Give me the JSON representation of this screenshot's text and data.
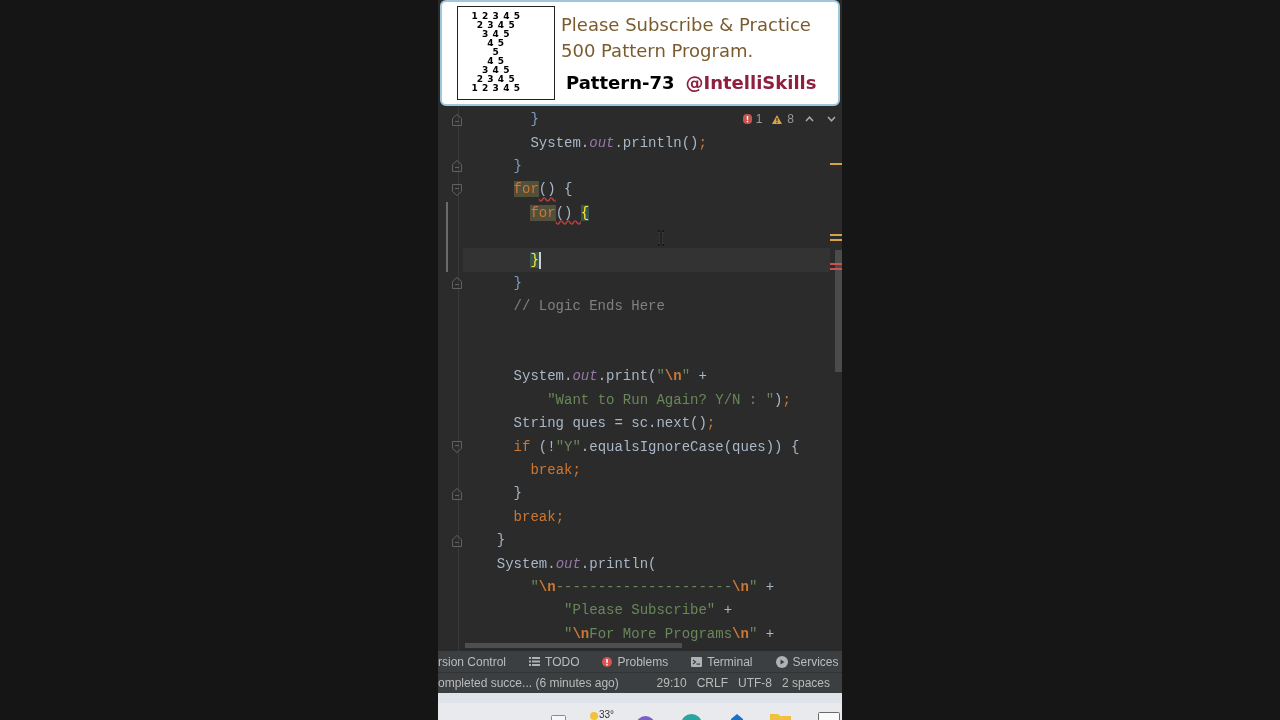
{
  "banner": {
    "pattern": [
      "1 2 3 4 5",
      "2 3 4 5",
      "3 4 5",
      "4 5",
      "5",
      "4 5",
      "3 4 5",
      "2 3 4 5",
      "1 2 3 4 5"
    ],
    "headline": [
      "Please Subscribe & Practice",
      "500 Pattern Program."
    ],
    "episode": "Pattern-73",
    "channel": "@IntelliSkills"
  },
  "editor": {
    "inspections": {
      "errors": "1",
      "warnings": "8"
    },
    "lines": [
      {
        "kind": "end",
        "tokens": [
          {
            "text": "      }",
            "kind": "bracket"
          }
        ],
        "current": false,
        "changed": false
      },
      {
        "kind": "plain",
        "tokens": [
          {
            "text": "      System.",
            "kind": "plain"
          },
          {
            "text": "out",
            "kind": "field"
          },
          {
            "text": ".println()",
            "kind": "plain"
          },
          {
            "text": ";",
            "kind": "semicolon"
          }
        ],
        "current": false,
        "changed": false
      },
      {
        "kind": "end",
        "tokens": [
          {
            "text": "    }",
            "kind": "bracket"
          }
        ],
        "current": false,
        "changed": false
      },
      {
        "kind": "start",
        "tokens": [
          {
            "text": "    for",
            "kind": "usage"
          },
          {
            "text": "()",
            "kind": "error"
          },
          {
            "text": " {",
            "kind": "plain"
          }
        ],
        "current": false,
        "changed": false
      },
      {
        "kind": "plain",
        "tokens": [
          {
            "text": "      for",
            "kind": "usage"
          },
          {
            "text": "() ",
            "kind": "error"
          },
          {
            "text": "{",
            "kind": "match"
          }
        ],
        "current": false,
        "changed": true
      },
      {
        "kind": "plain",
        "current": false,
        "changed": true
      },
      {
        "kind": "plain",
        "tokens": [
          {
            "text": "      }",
            "kind": "match"
          }
        ],
        "current": true,
        "changed": true
      },
      {
        "kind": "end",
        "tokens": [
          {
            "text": "    }",
            "kind": "bracket"
          }
        ],
        "current": false,
        "changed": false
      },
      {
        "kind": "plain",
        "tokens": [
          {
            "text": "    // Logic Ends Here",
            "kind": "comment"
          }
        ],
        "current": false,
        "changed": false
      },
      {
        "kind": "plain",
        "current": false,
        "changed": false
      },
      {
        "kind": "plain",
        "current": false,
        "changed": false
      },
      {
        "kind": "plain",
        "tokens": [
          {
            "text": "    System.",
            "kind": "plain"
          },
          {
            "text": "out",
            "kind": "field"
          },
          {
            "text": ".print(",
            "kind": "plain"
          },
          {
            "text": "\"",
            "kind": "string"
          },
          {
            "text": "\\n",
            "kind": "escape"
          },
          {
            "text": "\"",
            "kind": "string"
          },
          {
            "text": " +",
            "kind": "plain"
          }
        ],
        "current": false,
        "changed": false
      },
      {
        "kind": "plain",
        "tokens": [
          {
            "text": "        \"Want to Run Again? Y/N : \"",
            "kind": "string"
          },
          {
            "text": ")",
            "kind": "plain"
          },
          {
            "text": ";",
            "kind": "semicolon"
          }
        ],
        "current": false,
        "changed": false
      },
      {
        "kind": "plain",
        "tokens": [
          {
            "text": "    String ques = sc.next()",
            "kind": "plain"
          },
          {
            "text": ";",
            "kind": "semicolon"
          }
        ],
        "current": false,
        "changed": false
      },
      {
        "kind": "start",
        "tokens": [
          {
            "text": "    if",
            "kind": "keyword"
          },
          {
            "text": " (!",
            "kind": "plain"
          },
          {
            "text": "\"Y\"",
            "kind": "string"
          },
          {
            "text": ".equalsIgnoreCase(ques)) {",
            "kind": "plain"
          }
        ],
        "current": false,
        "changed": false
      },
      {
        "kind": "plain",
        "tokens": [
          {
            "text": "      break",
            "kind": "keyword"
          },
          {
            "text": ";",
            "kind": "semicolon"
          }
        ],
        "current": false,
        "changed": false
      },
      {
        "kind": "end",
        "tokens": [
          {
            "text": "    }",
            "kind": "plain"
          }
        ],
        "current": false,
        "changed": false
      },
      {
        "kind": "plain",
        "tokens": [
          {
            "text": "    break",
            "kind": "keyword"
          },
          {
            "text": ";",
            "kind": "semicolon"
          }
        ],
        "current": false,
        "changed": false
      },
      {
        "kind": "end",
        "tokens": [
          {
            "text": "  }",
            "kind": "plain"
          }
        ],
        "current": false,
        "changed": false
      },
      {
        "kind": "plain",
        "tokens": [
          {
            "text": "  System.",
            "kind": "plain"
          },
          {
            "text": "out",
            "kind": "field"
          },
          {
            "text": ".println(",
            "kind": "plain"
          }
        ],
        "current": false,
        "changed": false
      },
      {
        "kind": "plain",
        "tokens": [
          {
            "text": "      \"",
            "kind": "string"
          },
          {
            "text": "\\n",
            "kind": "escape"
          },
          {
            "text": "---------------------",
            "kind": "string"
          },
          {
            "text": "\\n",
            "kind": "escape"
          },
          {
            "text": "\"",
            "kind": "string"
          },
          {
            "text": " +",
            "kind": "plain"
          }
        ],
        "current": false,
        "changed": false
      },
      {
        "kind": "plain",
        "tokens": [
          {
            "text": "          \"Please Subscribe\"",
            "kind": "string"
          },
          {
            "text": " +",
            "kind": "plain"
          }
        ],
        "current": false,
        "changed": false
      },
      {
        "kind": "plain",
        "tokens": [
          {
            "text": "          \"",
            "kind": "string"
          },
          {
            "text": "\\n",
            "kind": "escape"
          },
          {
            "text": "For More Programs",
            "kind": "string"
          },
          {
            "text": "\\n",
            "kind": "escape"
          },
          {
            "text": "\"",
            "kind": "string"
          },
          {
            "text": " +",
            "kind": "plain"
          }
        ],
        "current": false,
        "changed": false
      }
    ]
  },
  "tool_windows": [
    {
      "label": "rsion Control",
      "kind": "plain"
    },
    {
      "label": "TODO",
      "kind": "list"
    },
    {
      "label": "Problems",
      "kind": "problems"
    },
    {
      "label": "Terminal",
      "kind": "terminal"
    },
    {
      "label": "Services",
      "kind": "services"
    }
  ],
  "status_bar": {
    "message": "ompleted succe... (6 minutes ago)",
    "items": [
      "29:10",
      "CRLF",
      "UTF-8",
      "2 spaces"
    ]
  },
  "taskbar": {
    "weather": "33°"
  }
}
